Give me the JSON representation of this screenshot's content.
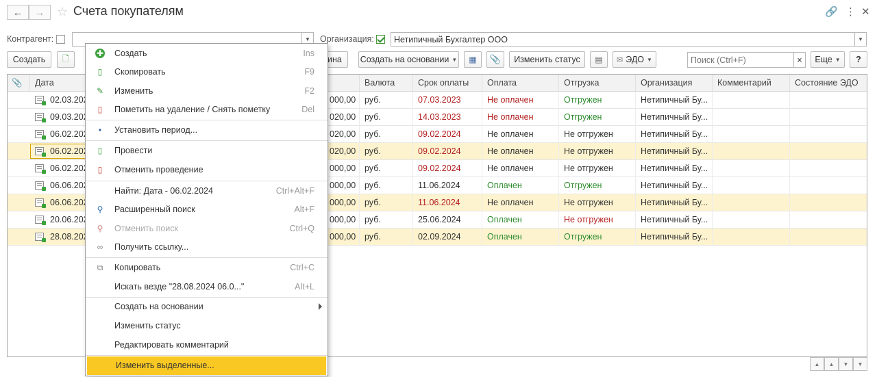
{
  "window": {
    "title": "Счета покупателям"
  },
  "filters": {
    "counterparty_label": "Контрагент:",
    "counterparty_value": "",
    "organization_label": "Организация:",
    "organization_value": "Нетипичный Бухгалтер ООО"
  },
  "toolbar": {
    "create": "Создать",
    "cut_label": "ина",
    "create_based_on": "Создать на основании",
    "change_status": "Изменить статус",
    "edo": "ЭДО",
    "search_placeholder": "Поиск (Ctrl+F)",
    "clear": "×",
    "more": "Еще",
    "help": "?"
  },
  "table": {
    "columns": [
      "Дата",
      "Валюта",
      "Срок оплаты",
      "Оплата",
      "Отгрузка",
      "Организация",
      "Комментарий",
      "Состояние ЭДО"
    ],
    "rows": [
      {
        "date": "02.03.2023",
        "sum": "000,00",
        "currency": "руб.",
        "due": "07.03.2023",
        "due_red": true,
        "payment": "Не оплачен",
        "payment_state": "red",
        "shipment": "Отгружен",
        "shipment_state": "green",
        "org": "Нетипичный Бу...",
        "hl": false
      },
      {
        "date": "09.03.2023",
        "sum": "020,00",
        "currency": "руб.",
        "due": "14.03.2023",
        "due_red": true,
        "payment": "Не оплачен",
        "payment_state": "red",
        "shipment": "Отгружен",
        "shipment_state": "green",
        "org": "Нетипичный Бу...",
        "hl": false
      },
      {
        "date": "06.02.2024",
        "sum": "020,00",
        "currency": "руб.",
        "due": "09.02.2024",
        "due_red": true,
        "payment": "Не оплачен",
        "payment_state": "plain",
        "shipment": "Не отгружен",
        "shipment_state": "plain",
        "org": "Нетипичный Бу...",
        "hl": false
      },
      {
        "date": "06.02.2024",
        "sum": "020,00",
        "currency": "руб.",
        "due": "09.02.2024",
        "due_red": true,
        "payment": "Не оплачен",
        "payment_state": "plain",
        "shipment": "Не отгружен",
        "shipment_state": "plain",
        "org": "Нетипичный Бу...",
        "hl": true
      },
      {
        "date": "06.02.2024",
        "sum": "000,00",
        "currency": "руб.",
        "due": "09.02.2024",
        "due_red": true,
        "payment": "Не оплачен",
        "payment_state": "plain",
        "shipment": "Не отгружен",
        "shipment_state": "plain",
        "org": "Нетипичный Бу...",
        "hl": false
      },
      {
        "date": "06.06.2024",
        "sum": "000,00",
        "currency": "руб.",
        "due": "11.06.2024",
        "due_red": false,
        "payment": "Оплачен",
        "payment_state": "green",
        "shipment": "Отгружен",
        "shipment_state": "green",
        "org": "Нетипичный Бу...",
        "hl": false
      },
      {
        "date": "06.06.2024",
        "sum": "000,00",
        "currency": "руб.",
        "due": "11.06.2024",
        "due_red": true,
        "payment": "Не оплачен",
        "payment_state": "plain",
        "shipment": "Не отгружен",
        "shipment_state": "plain",
        "org": "Нетипичный Бу...",
        "hl": true
      },
      {
        "date": "20.06.2024",
        "sum": "000,00",
        "currency": "руб.",
        "due": "25.06.2024",
        "due_red": false,
        "payment": "Оплачен",
        "payment_state": "green",
        "shipment": "Не отгружен",
        "shipment_state": "red",
        "org": "Нетипичный Бу...",
        "hl": false
      },
      {
        "date": "28.08.2024",
        "sum": "000,00",
        "currency": "руб.",
        "due": "02.09.2024",
        "due_red": false,
        "payment": "Оплачен",
        "payment_state": "green",
        "shipment": "Отгружен",
        "shipment_state": "green",
        "org": "Нетипичный Бу...",
        "hl": true
      }
    ]
  },
  "context_menu": {
    "items": [
      {
        "label": "Создать",
        "shortcut": "Ins",
        "icon": "plus-circle-icon"
      },
      {
        "label": "Скопировать",
        "shortcut": "F9",
        "icon": "copy-doc-icon"
      },
      {
        "label": "Изменить",
        "shortcut": "F2",
        "icon": "pencil-icon"
      },
      {
        "label": "Пометить на удаление / Снять пометку",
        "shortcut": "Del",
        "icon": "delete-mark-icon"
      },
      {
        "label": "Установить период...",
        "shortcut": "",
        "icon": "period-icon"
      },
      {
        "label": "Провести",
        "shortcut": "",
        "icon": "post-doc-icon"
      },
      {
        "label": "Отменить проведение",
        "shortcut": "",
        "icon": "unpost-doc-icon"
      },
      {
        "label": "Найти: Дата - 06.02.2024",
        "shortcut": "Ctrl+Alt+F",
        "icon": ""
      },
      {
        "label": "Расширенный поиск",
        "shortcut": "Alt+F",
        "icon": "advanced-search-icon"
      },
      {
        "label": "Отменить поиск",
        "shortcut": "Ctrl+Q",
        "icon": "cancel-search-icon"
      },
      {
        "label": "Получить ссылку...",
        "shortcut": "",
        "icon": "link-icon"
      },
      {
        "label": "Копировать",
        "shortcut": "Ctrl+C",
        "icon": "copy-icon"
      },
      {
        "label": "Искать везде \"28.08.2024 06.0...\"",
        "shortcut": "Alt+L",
        "icon": ""
      },
      {
        "label": "Создать на основании",
        "shortcut": "",
        "icon": ""
      },
      {
        "label": "Изменить статус",
        "shortcut": "",
        "icon": ""
      },
      {
        "label": "Редактировать комментарий",
        "shortcut": "",
        "icon": ""
      },
      {
        "label": "Изменить выделенные...",
        "shortcut": "",
        "icon": ""
      }
    ]
  },
  "colors": {
    "accent": "#f9c823",
    "highlight_row": "#fdf3cf",
    "red": "#b32020",
    "green": "#2e8b2e"
  }
}
